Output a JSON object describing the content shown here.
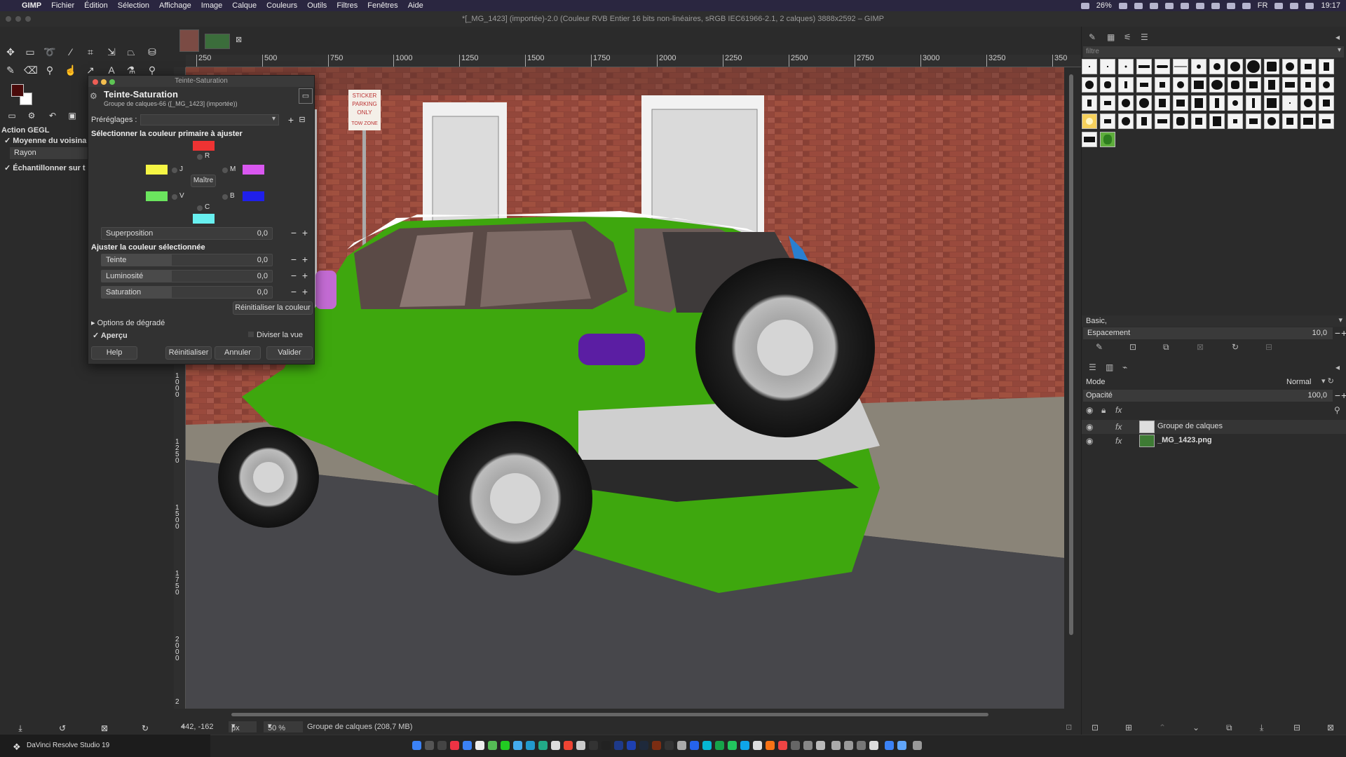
{
  "menubar": {
    "items": [
      "GIMP",
      "Fichier",
      "Édition",
      "Sélection",
      "Affichage",
      "Image",
      "Calque",
      "Couleurs",
      "Outils",
      "Filtres",
      "Fenêtres",
      "Aide"
    ],
    "battery": "26%",
    "clock": "19:17",
    "input_source": "FR"
  },
  "window_title": "*[_MG_1423] (importée)-2.0 (Couleur RVB Entier 16 bits non-linéaires, sRGB IEC61966-2.1, 2 calques) 3888x2592 – GIMP",
  "toolbox": {
    "action_title": "Action GEGL",
    "opt1": "Moyenne du voisina",
    "opt2": "Rayon",
    "opt3": "Échantillonner sur t"
  },
  "ruler": {
    "h_ticks": [
      "250",
      "500",
      "750",
      "1000",
      "1250",
      "1500",
      "1750",
      "2000",
      "2250",
      "2500",
      "2750",
      "3000",
      "3250",
      "350"
    ],
    "v_ticks": [
      "1000",
      "1250",
      "1500",
      "1750",
      "2000",
      "2"
    ]
  },
  "dialog": {
    "window_title": "Teinte-Saturation",
    "title": "Teinte-Saturation",
    "subtitle": "Groupe de calques-66 ([_MG_1423] (importée))",
    "presets_label": "Préréglages :",
    "select_color_label": "Sélectionner la couleur primaire à ajuster",
    "colors": {
      "R": "R",
      "J": "J",
      "M": "M",
      "V": "V",
      "B": "B",
      "C": "C",
      "master": "Maître"
    },
    "overlap": {
      "label": "Superposition",
      "value": "0,0"
    },
    "adjust_label": "Ajuster la couleur sélectionnée",
    "hue": {
      "label": "Teinte",
      "value": "0,0"
    },
    "lightness": {
      "label": "Luminosité",
      "value": "0,0"
    },
    "saturation": {
      "label": "Saturation",
      "value": "0,0"
    },
    "reset_color": "Réinitialiser la couleur",
    "blend_options": "Options de dégradé",
    "preview": "Aperçu",
    "split_view": "Diviser la vue",
    "buttons": {
      "help": "Help",
      "reset": "Réinitialiser",
      "cancel": "Annuler",
      "ok": "Valider"
    },
    "swatch_colors": {
      "R": "#ee3333",
      "J": "#f5f544",
      "M": "#d957f0",
      "V": "#6be55e",
      "B": "#1f1fea",
      "C": "#68f0f0"
    }
  },
  "statusbar": {
    "coords": "442, -162",
    "unit": "px",
    "zoom": "50 %",
    "info": "Groupe de calques (208,7 MB)"
  },
  "dock": {
    "davinci": "DaVinci Resolve Studio 19"
  },
  "brushes": {
    "filter_placeholder": "filtre",
    "preset": "Basic,",
    "spacing_label": "Espacement",
    "spacing_value": "10,0"
  },
  "layers": {
    "mode_label": "Mode",
    "mode_value": "Normal",
    "opacity_label": "Opacité",
    "opacity_value": "100,0",
    "items": [
      "Groupe de calques",
      "_MG_1423.png"
    ]
  },
  "canvas": {
    "sign": [
      "STICKER",
      "PARKING",
      "ONLY",
      "TOW ZONE"
    ]
  }
}
